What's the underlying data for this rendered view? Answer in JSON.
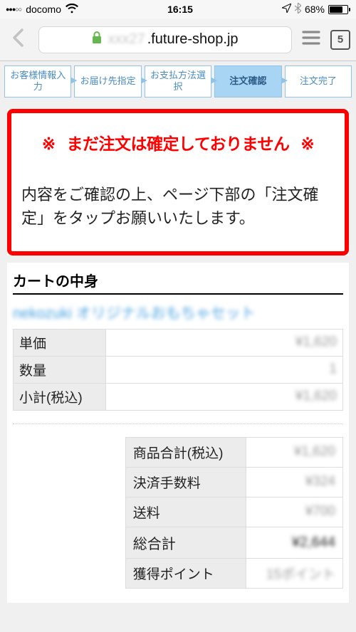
{
  "status": {
    "carrier": "docomo",
    "time": "16:15",
    "percent": "68%"
  },
  "nav": {
    "url_visible": ".future-shop.jp",
    "tab_count": "5"
  },
  "steps": [
    "お客様情報入力",
    "お届け先指定",
    "お支払方法選択",
    "注文確認",
    "注文完了"
  ],
  "steps_active_index": 3,
  "notice": {
    "sym": "※",
    "title": "まだ注文は確定しておりません",
    "body": "内容をご確認の上、ページ下部の「注文確定」をタップお願いいたします。"
  },
  "cart": {
    "heading": "カートの中身",
    "product_name": "nekozuki オリジナルおもちゃセット",
    "rows": {
      "unit_price_label": "単価",
      "unit_price": "¥1,620",
      "qty_label": "数量",
      "qty": "1",
      "subtotal_label": "小計(税込)",
      "subtotal": "¥1,620"
    },
    "totals": {
      "goods_label": "商品合計(税込)",
      "goods": "¥1,620",
      "fee_label": "決済手数料",
      "fee": "¥324",
      "ship_label": "送料",
      "ship": "¥700",
      "grand_label": "総合計",
      "grand": "¥2,644",
      "points_label": "獲得ポイント",
      "points": "15ポイント"
    }
  }
}
